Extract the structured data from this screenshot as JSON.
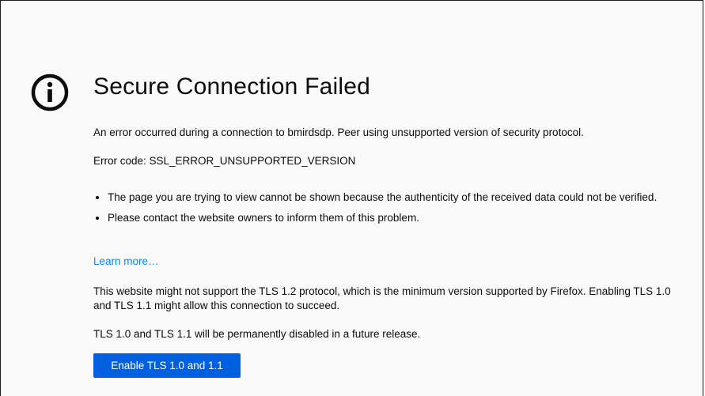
{
  "page": {
    "title": "Secure Connection Failed",
    "description": "An error occurred during a connection to bmirdsdp. Peer using unsupported version of security protocol.",
    "error_code": "Error code: SSL_ERROR_UNSUPPORTED_VERSION",
    "bullets": [
      "The page you are trying to view cannot be shown because the authenticity of the received data could not be verified.",
      "Please contact the website owners to inform them of this problem."
    ],
    "learn_more": "Learn more…",
    "tls_note": "This website might not support the TLS 1.2 protocol, which is the minimum version supported by Firefox. Enabling TLS 1.0 and TLS 1.1 might allow this connection to succeed.",
    "tls_future": "TLS 1.0 and TLS 1.1 will be permanently disabled in a future release.",
    "enable_button": "Enable TLS 1.0 and 1.1",
    "icon": "info-icon"
  },
  "colors": {
    "background": "#f9f9fa",
    "text": "#0c0c0d",
    "link": "#0a84ff",
    "button": "#0060df",
    "button_text": "#ffffff"
  }
}
